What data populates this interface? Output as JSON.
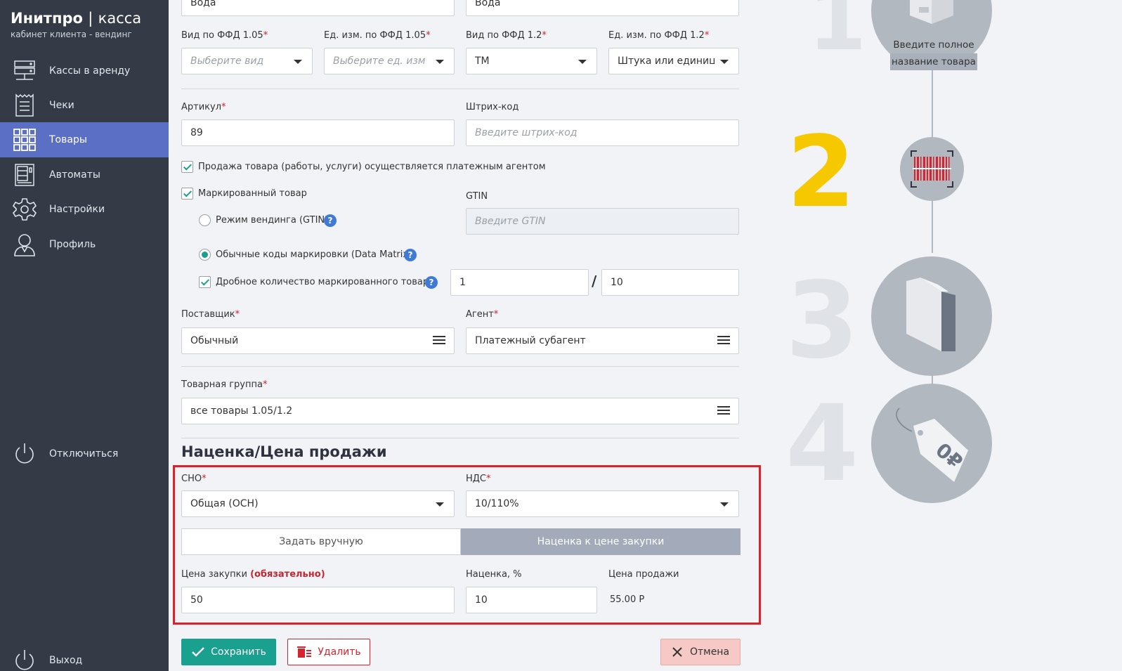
{
  "brand": {
    "name": "Инитпро",
    "separator": "|",
    "product": "касса",
    "subtitle": "кабинет клиента - вендинг"
  },
  "nav": {
    "items": [
      {
        "label": "Кассы в аренду",
        "icon": "server-icon"
      },
      {
        "label": "Чеки",
        "icon": "receipt-icon"
      },
      {
        "label": "Товары",
        "icon": "grid-icon",
        "active": true
      },
      {
        "label": "Автоматы",
        "icon": "vending-machine-icon"
      },
      {
        "label": "Настройки",
        "icon": "gear-icon"
      },
      {
        "label": "Профиль",
        "icon": "user-icon"
      }
    ],
    "disconnect": "Отключиться",
    "logout": "Выход"
  },
  "form": {
    "name_left": "Вода",
    "name_right": "Вода",
    "ffd105_type": {
      "label": "Вид по ФФД 1.05",
      "placeholder": "Выберите вид"
    },
    "ffd105_unit": {
      "label": "Ед. изм. по ФФД 1.05",
      "placeholder": "Выберите ед. изм"
    },
    "ffd12_type": {
      "label": "Вид по ФФД 1.2",
      "value": "ТМ"
    },
    "ffd12_unit": {
      "label": "Ед. изм. по ФФД 1.2",
      "value": "Штука или единица"
    },
    "article": {
      "label": "Артикул",
      "value": "89"
    },
    "barcode": {
      "label": "Штрих-код",
      "placeholder": "Введите штрих-код"
    },
    "agent_sale": "Продажа товара (работы, услуги) осуществляется платежным агентом",
    "marked": "Маркированный товар",
    "gtin": {
      "label": "GTIN",
      "placeholder": "Введите GTIN"
    },
    "vending_mode": "Режим вендинга (GTIN)",
    "datamatrix_mode": "Обычные коды маркировки (Data Matrix)",
    "fractional": "Дробное количество маркированного товара",
    "fraction_num": "1",
    "fraction_slash": "/",
    "fraction_den": "10",
    "supplier": {
      "label": "Поставщик",
      "value": "Обычный"
    },
    "agent": {
      "label": "Агент",
      "value": "Платежный субагент"
    },
    "group": {
      "label": "Товарная группа",
      "value": "все товары 1.05/1.2"
    },
    "help_mark": "?",
    "required_mark": "*"
  },
  "pricing": {
    "title": "Наценка/Цена продажи",
    "sno": {
      "label": "СНО",
      "value": "Общая (ОСН)"
    },
    "nds": {
      "label": "НДС",
      "value": "10/110%"
    },
    "mode_manual": "Задать вручную",
    "mode_markup": "Наценка к цене закупки",
    "purchase": {
      "label": "Цена закупки",
      "note": "(обязательно)",
      "value": "50"
    },
    "markup": {
      "label": "Наценка, %",
      "value": "10"
    },
    "sale": {
      "label": "Цена продажи",
      "value": "55.00 Р"
    }
  },
  "actions": {
    "save": "Сохранить",
    "delete": "Удалить",
    "cancel": "Отмена"
  },
  "steps": {
    "n1": "1",
    "n2": "2",
    "n3": "3",
    "n4": "4",
    "step1_line1": "Введите полное",
    "step1_line2": "название товара",
    "price_tag": "0₽"
  },
  "colors": {
    "sidebar": "#343a46",
    "active": "#5b6fc5",
    "accent": "#1aa08f",
    "danger": "#d8232f",
    "step_active": "#f5c800",
    "step_idle": "#dfe2e6"
  }
}
